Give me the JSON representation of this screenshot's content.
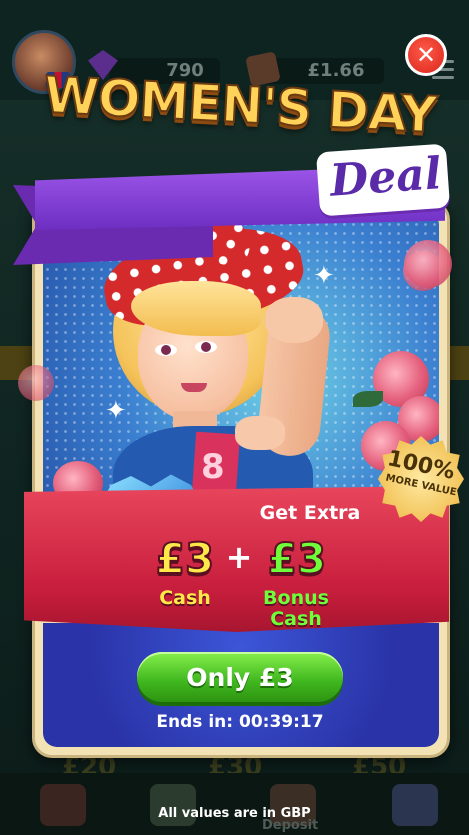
{
  "background": {
    "gem_count": "790",
    "cash_balance": "£1.66",
    "amount_left": "£20",
    "amount_mid": "£30",
    "amount_right": "£50",
    "deposit_tab": "Deposit",
    "footer_note": "All values are in GBP"
  },
  "promo": {
    "title": "WOMEN'S DAY",
    "subtitle": "Deal",
    "close_label": "✕",
    "badge_value": "100%",
    "badge_text": "MORE VALUE",
    "get_extra": "Get Extra",
    "cash_amount": "£3",
    "plus": "+",
    "bonus_amount": "£3",
    "cash_label": "Cash",
    "bonus_label_1": "Bonus",
    "bonus_label_2": "Cash",
    "buy_label": "Only £3",
    "timer": "Ends in: 00:39:17",
    "sash_mark": "8"
  },
  "colors": {
    "accent_green": "#3fb61e",
    "banner_red": "#c81e3d",
    "ribbon_purple": "#6d2ec2",
    "cash_yellow": "#ffe84a",
    "bonus_green": "#6fff3a"
  }
}
